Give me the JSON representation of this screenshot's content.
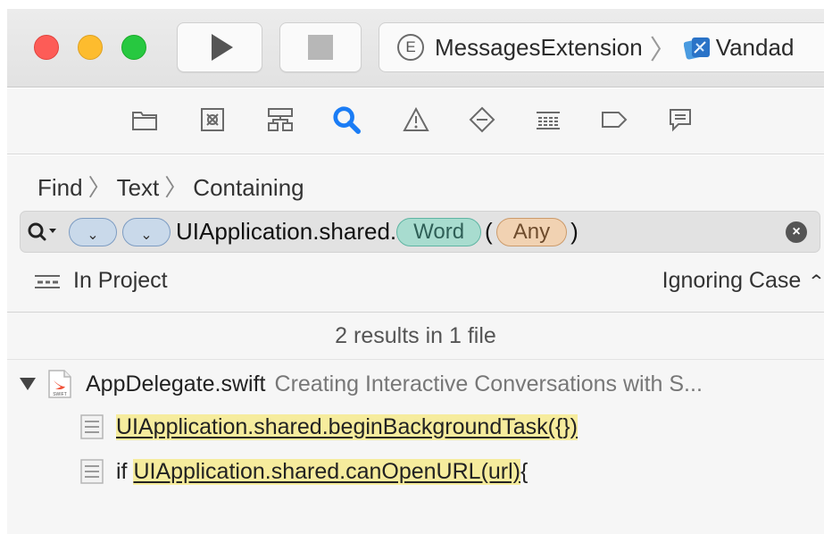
{
  "toolbar": {
    "scheme_badge": "E",
    "scheme_name": "MessagesExtension",
    "scheme_separator": "〉",
    "destination": "Vandad"
  },
  "navigator": {
    "icons": [
      "folder-icon",
      "symbol-icon",
      "hierarchy-icon",
      "search-icon",
      "warning-icon",
      "test-icon",
      "debug-icon",
      "breakpoint-icon",
      "report-icon"
    ],
    "active": "search-icon",
    "active_color": "#1a7cf5"
  },
  "find": {
    "crumbs": [
      "Find",
      "Text",
      "Containing"
    ],
    "crumb_sep": "〉",
    "query_prefix": "Q",
    "query_text": "UIApplication.shared.",
    "token_word": "Word",
    "paren_open": "(",
    "token_any": "Any",
    "paren_close": ")",
    "clear": "×",
    "scope": "In Project",
    "case_mode": "Ignoring Case",
    "case_chevron": "⌃⌄"
  },
  "results": {
    "summary": "2 results in 1 file",
    "file": {
      "name": "AppDelegate.swift",
      "description": "Creating Interactive Conversations with S..."
    },
    "matches": [
      {
        "prefix": "",
        "match": "UIApplication.shared.beginBackgroundTask({})",
        "suffix": ""
      },
      {
        "prefix": "if ",
        "match": "UIApplication.shared.canOpenURL(url)",
        "suffix": "{"
      }
    ]
  },
  "colors": {
    "highlight": "#f6ec9d",
    "word_token": "#a8dccf",
    "any_token": "#f1d2b2"
  }
}
